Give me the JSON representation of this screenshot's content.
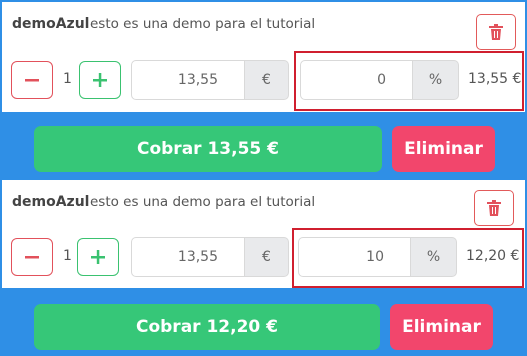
{
  "icons": {
    "trash": "trash-icon",
    "minus": "minus-icon",
    "plus": "plus-icon"
  },
  "colors": {
    "background": "#2f8fe6",
    "cobrar": "#36c778",
    "eliminar": "#f2466c",
    "minus": "#e2515b",
    "plus": "#3ac270",
    "highlight": "#d01f2f"
  },
  "items": [
    {
      "name": "demoAzul",
      "description": "esto es una demo para el tutorial",
      "quantity": "1",
      "price": "13,55",
      "currency": "€",
      "discount": "0",
      "percent_symbol": "%",
      "total": "13,55 €",
      "cobrar_label": "Cobrar 13,55 €",
      "eliminar_label": "Eliminar"
    },
    {
      "name": "demoAzul",
      "description": "esto es una demo para el tutorial",
      "quantity": "1",
      "price": "13,55",
      "currency": "€",
      "discount": "10",
      "percent_symbol": "%",
      "total": "12,20 €",
      "cobrar_label": "Cobrar 12,20 €",
      "eliminar_label": "Eliminar"
    }
  ]
}
